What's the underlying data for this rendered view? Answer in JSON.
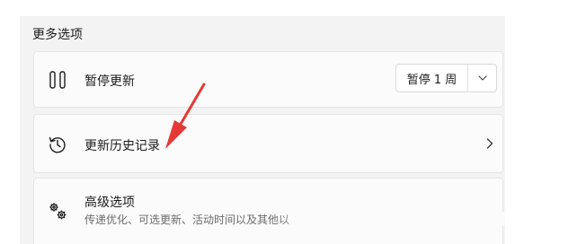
{
  "section_title": "更多选项",
  "pause_updates": {
    "label": "暂停更新",
    "icon": "pause-icon",
    "dropdown": {
      "selected": "暂停 1 周",
      "arrow_icon": "chevron-down-icon"
    }
  },
  "update_history": {
    "label": "更新历史记录",
    "icon": "history-icon",
    "chevron_icon": "chevron-right-icon"
  },
  "advanced_options": {
    "label": "高级选项",
    "subtitle": "传递优化、可选更新、活动时间以及其他以",
    "icon": "gears-icon"
  },
  "annotation": {
    "type": "red-arrow",
    "color": "#e53935"
  },
  "colors": {
    "panel_bg": "#f3f3f3",
    "card_bg": "#fbfbfb",
    "text": "#1b1b1b",
    "secondary_text": "#6b6b6b"
  }
}
